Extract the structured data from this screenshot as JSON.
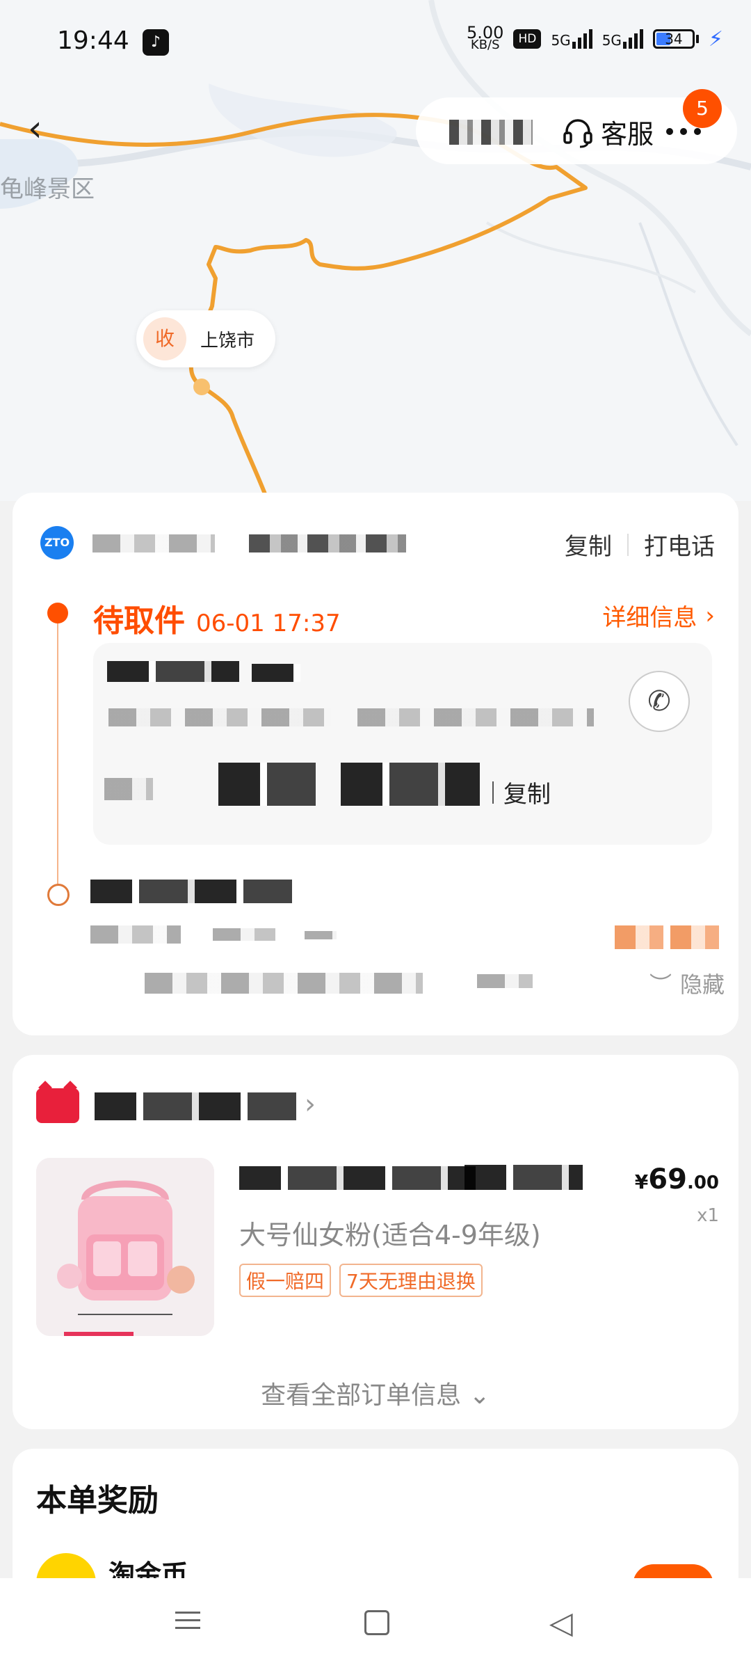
{
  "status_bar": {
    "time": "19:44",
    "app_icon": "tiktok-icon",
    "net_speed_value": "5.00",
    "net_speed_unit": "KB/S",
    "hd_label": "HD",
    "signal1_label": "5G",
    "signal2_label": "5G",
    "battery": "34"
  },
  "map": {
    "area_label": "龟峰景区",
    "receiver_badge": "收",
    "receiver_city": "上饶市",
    "route_color": "#f0a030"
  },
  "header": {
    "customer_service": "客服",
    "badge_count": "5"
  },
  "logistics": {
    "copy_label": "复制",
    "call_label": "打电话",
    "status": "待取件",
    "status_time": "06-01 17:37",
    "detail_link": "详细信息",
    "pickup_copy_label": "复制",
    "hide_label": "隐藏"
  },
  "order": {
    "product_desc": "大号仙女粉(适合4-9年级)",
    "tags": [
      "假一赔四",
      "7天无理由退换"
    ],
    "price_currency": "¥",
    "price_integer": "69",
    "price_decimal": ".00",
    "quantity": "x1",
    "view_all": "查看全部订单信息"
  },
  "rewards": {
    "title": "本单奖励",
    "item_label": "淘金币"
  },
  "colors": {
    "accent": "#ff5000",
    "accent_text": "#ff5a00",
    "route": "#f0a030"
  }
}
